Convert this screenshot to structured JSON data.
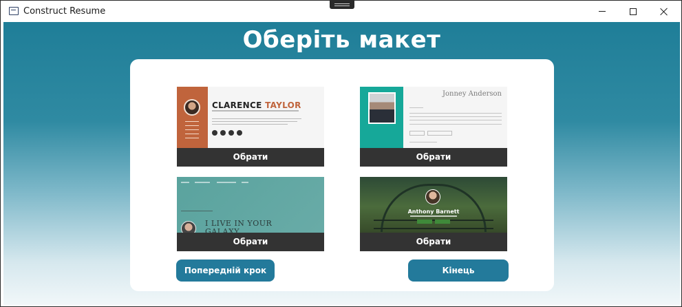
{
  "window": {
    "title": "Construct Resume"
  },
  "page": {
    "title": "Оберіть макет"
  },
  "templates": [
    {
      "preview": {
        "first_name": "CLARENCE",
        "last_name": "TAYLOR"
      },
      "select_label": "Обрати"
    },
    {
      "preview": {
        "name": "Jonney Anderson"
      },
      "select_label": "Обрати"
    },
    {
      "preview": {
        "hero": "I LIVE IN YOUR GALAXY"
      },
      "select_label": "Обрати"
    },
    {
      "preview": {
        "name": "Anthony Barnett"
      },
      "select_label": "Обрати"
    }
  ],
  "actions": {
    "prev_label": "Попередній крок",
    "finish_label": "Кінець"
  },
  "colors": {
    "accent": "#237a9b",
    "select_bar": "#333333",
    "header_gradient_top": "#1f7e98"
  }
}
